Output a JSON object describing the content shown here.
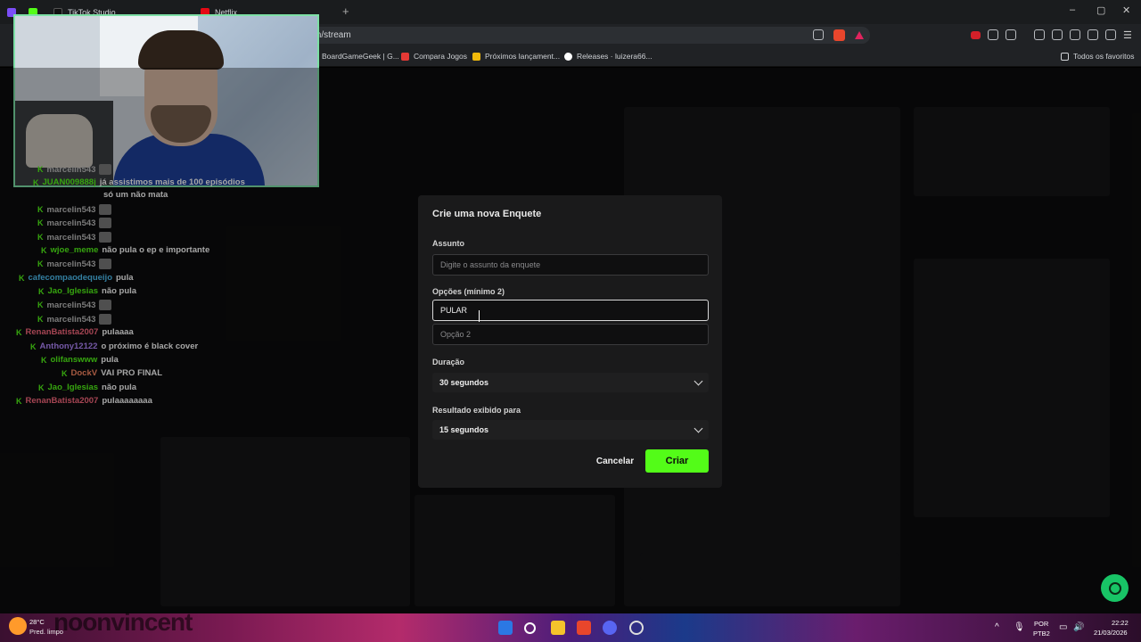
{
  "browser": {
    "tabs": [
      {
        "label": "",
        "color": "#7b4df6"
      },
      {
        "label": "",
        "color": "#53fc18"
      },
      {
        "label": "TikTok Studio",
        "color": "#111111"
      },
      {
        "label": "Netflix",
        "color": "#e50914"
      }
    ],
    "new_tab_label": "+",
    "url": "m/stream",
    "bookmarks": [
      {
        "label": "BoardGameGeek | G...",
        "color": "#ff5100"
      },
      {
        "label": "Compara Jogos",
        "color": "#e53935"
      },
      {
        "label": "Próximos lançament...",
        "color": "#f0b90b"
      },
      {
        "label": "Releases · luizera66...",
        "color": "#ffffff"
      }
    ],
    "all_bookmarks_label": "Todos os favoritos"
  },
  "chat": [
    {
      "user": "marcelin543",
      "message": "",
      "user_color": "#bdbdbd",
      "emote": true
    },
    {
      "user": "JUAN009888j",
      "message": "já assistimos mais de 100 episódios",
      "user_color": "#53fc18",
      "emote": false
    },
    {
      "user": "",
      "message": "só um não mata",
      "user_color": "#ffffff",
      "emote": false
    },
    {
      "user": "marcelin543",
      "message": "",
      "user_color": "#bdbdbd",
      "emote": true
    },
    {
      "user": "marcelin543",
      "message": "",
      "user_color": "#bdbdbd",
      "emote": true
    },
    {
      "user": "marcelin543",
      "message": "",
      "user_color": "#bdbdbd",
      "emote": true
    },
    {
      "user": "wjoe_meme",
      "message": "não pula o ep e importante",
      "user_color": "#53fc18",
      "emote": false
    },
    {
      "user": "marcelin543",
      "message": "",
      "user_color": "#bdbdbd",
      "emote": true
    },
    {
      "user": "cafecompaodequeijo",
      "message": "pula",
      "user_color": "#4fc3f7",
      "emote": false
    },
    {
      "user": "Jao_Iglesias",
      "message": "não pula",
      "user_color": "#53fc18",
      "emote": false
    },
    {
      "user": "marcelin543",
      "message": "",
      "user_color": "#bdbdbd",
      "emote": true
    },
    {
      "user": "marcelin543",
      "message": "",
      "user_color": "#bdbdbd",
      "emote": true
    },
    {
      "user": "RenanBatista2007",
      "message": "pulaaaa",
      "user_color": "#ff6b81",
      "emote": false
    },
    {
      "user": "Anthony12122",
      "message": "o próximo é black cover",
      "user_color": "#b388ff",
      "emote": false
    },
    {
      "user": "olifanswww",
      "message": "pula",
      "user_color": "#53fc18",
      "emote": false
    },
    {
      "user": "DockV",
      "message": "VAI PRO FINAL",
      "user_color": "#ff8a65",
      "emote": false
    },
    {
      "user": "Jao_Iglesias",
      "message": "não pula",
      "user_color": "#53fc18",
      "emote": false
    },
    {
      "user": "RenanBatista2007",
      "message": "pulaaaaaaaa",
      "user_color": "#ff6b81",
      "emote": false
    }
  ],
  "modal": {
    "title": "Crie uma nova Enquete",
    "subject_label": "Assunto",
    "subject_placeholder": "Digite o assunto da enquete",
    "options_label": "Opções (mínimo 2)",
    "option1_value": "PULAR",
    "option2_placeholder": "Opção 2",
    "duration_label": "Duração",
    "duration_value": "30 segundos",
    "result_label": "Resultado exibido para",
    "result_value": "15 segundos",
    "cancel_label": "Cancelar",
    "create_label": "Criar"
  },
  "taskbar": {
    "temperature": "28°C",
    "weather": "Pred. limpo",
    "brand_overlay": "noonvincent",
    "language": "POR",
    "layout": "PTB2",
    "time": "22:22",
    "date": "21/03/2026"
  },
  "colors": {
    "accent": "#53fc18",
    "help": "#18c466"
  }
}
